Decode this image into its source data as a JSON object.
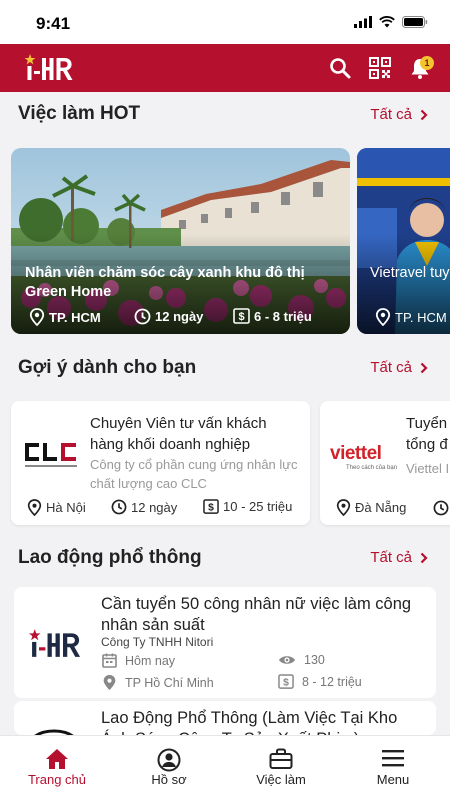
{
  "status": {
    "time": "9:41"
  },
  "header": {
    "notification_count": "1"
  },
  "sections": {
    "hot": {
      "title": "Việc làm HOT",
      "see_all": "Tất cả"
    },
    "suggest": {
      "title": "Gợi ý dành cho bạn",
      "see_all": "Tất cả"
    },
    "labor": {
      "title": "Lao động phổ thông",
      "see_all": "Tất cả"
    }
  },
  "hot_jobs": [
    {
      "title": "Nhân viên chăm sóc cây xanh khu đô thị Green Home",
      "location": "TP. HCM",
      "days": "12 ngày",
      "salary": "6 - 8 triệu"
    },
    {
      "title": "Vietravel tuyển dụng nhân viên hỗ trợ thông",
      "location": "TP. HCM"
    }
  ],
  "suggested_jobs": [
    {
      "title": "Chuyên Viên tư vấn khách hàng khối doanh nghiệp",
      "company": "Công ty cổ phần cung ứng nhân lực chất lượng cao CLC",
      "logo_text": "CLC",
      "location": "Hà Nội",
      "days": "12 ngày",
      "salary": "10 - 25 triệu"
    },
    {
      "title": "Tuyển tổng đ",
      "company": "Viettel I",
      "logo_text": "viettel",
      "logo_tagline": "Theo cách của bạn",
      "location": "Đà Nẵng"
    }
  ],
  "labor_jobs": [
    {
      "title": "Cần tuyển 50 công nhân nữ việc làm công nhân sản suất",
      "company": "Công Ty TNHH Nitori",
      "posted": "Hôm nay",
      "views": "130",
      "location": "TP Hồ Chí Minh",
      "salary": "8 - 12 triệu"
    },
    {
      "title": "Lao Động Phổ Thông (Làm Việc Tại Kho Ánh Sáng Công Ty Sản Xuất Phim)"
    }
  ],
  "bottom_nav": [
    {
      "label": "Trang chủ",
      "icon": "home-icon",
      "active": true
    },
    {
      "label": "Hồ sơ",
      "icon": "profile-icon"
    },
    {
      "label": "Việc làm",
      "icon": "briefcase-icon"
    },
    {
      "label": "Menu",
      "icon": "menu-icon"
    }
  ],
  "colors": {
    "brand": "#b5102e",
    "accent_star": "#f4c430",
    "background": "#f2f2f4"
  }
}
